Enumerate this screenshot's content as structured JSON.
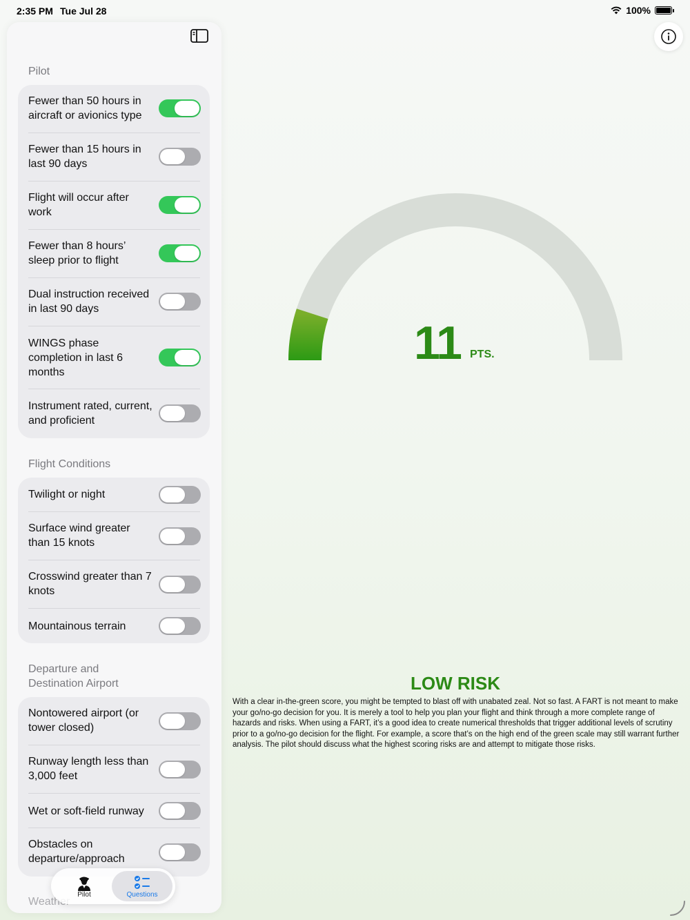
{
  "status_bar": {
    "time": "2:35 PM",
    "date": "Tue Jul 28",
    "battery": "100%"
  },
  "sidebar": {
    "sections": [
      {
        "title": "Pilot",
        "items": [
          {
            "label": "Fewer than 50 hours in aircraft or avionics type",
            "on": true
          },
          {
            "label": "Fewer than 15 hours in last 90 days",
            "on": false
          },
          {
            "label": "Flight will occur after work",
            "on": true
          },
          {
            "label": "Fewer than 8 hours’ sleep prior to flight",
            "on": true
          },
          {
            "label": "Dual instruction received in last 90 days",
            "on": false
          },
          {
            "label": "WINGS phase completion in last 6 months",
            "on": true
          },
          {
            "label": "Instrument rated, current, and proficient",
            "on": false
          }
        ]
      },
      {
        "title": "Flight Conditions",
        "items": [
          {
            "label": "Twilight or night",
            "on": false
          },
          {
            "label": "Surface wind greater than 15 knots",
            "on": false
          },
          {
            "label": "Crosswind greater than 7 knots",
            "on": false
          },
          {
            "label": "Mountainous terrain",
            "on": false
          }
        ]
      },
      {
        "title": "Departure and Destination Airport",
        "items": [
          {
            "label": "Nontowered airport (or tower closed)",
            "on": false
          },
          {
            "label": "Runway length less than 3,000 feet",
            "on": false
          },
          {
            "label": "Wet or soft-field runway",
            "on": false
          },
          {
            "label": "Obstacles on departure/approach",
            "on": false
          }
        ]
      }
    ],
    "next_section_peek": "Weather"
  },
  "tab_bar": {
    "tabs": [
      {
        "label": "Pilot"
      },
      {
        "label": "Questions"
      }
    ],
    "selected": 1
  },
  "score": {
    "value": "11",
    "unit": "PTS.",
    "fill_fraction": 0.1
  },
  "risk": {
    "title": "LOW RISK",
    "description": "With a clear in-the-green score, you might be tempted to blast off with unabated zeal. Not so fast. A FART is not meant to make your go/no-go decision for you. It is merely a tool to help you plan your flight and think through a more complete range of hazards and risks. When using a FART, it’s a good idea to create numerical thresholds that trigger additional levels of scrutiny prior to a go/no-go decision for the flight. For example, a score that’s on the high end of the green scale may still warrant further analysis. The pilot should discuss what the highest scoring risks are and attempt to mitigate those risks."
  },
  "colors": {
    "accent_green": "#2c8a16",
    "toggle_on": "#34c759",
    "tab_selected": "#1a7ae8"
  }
}
